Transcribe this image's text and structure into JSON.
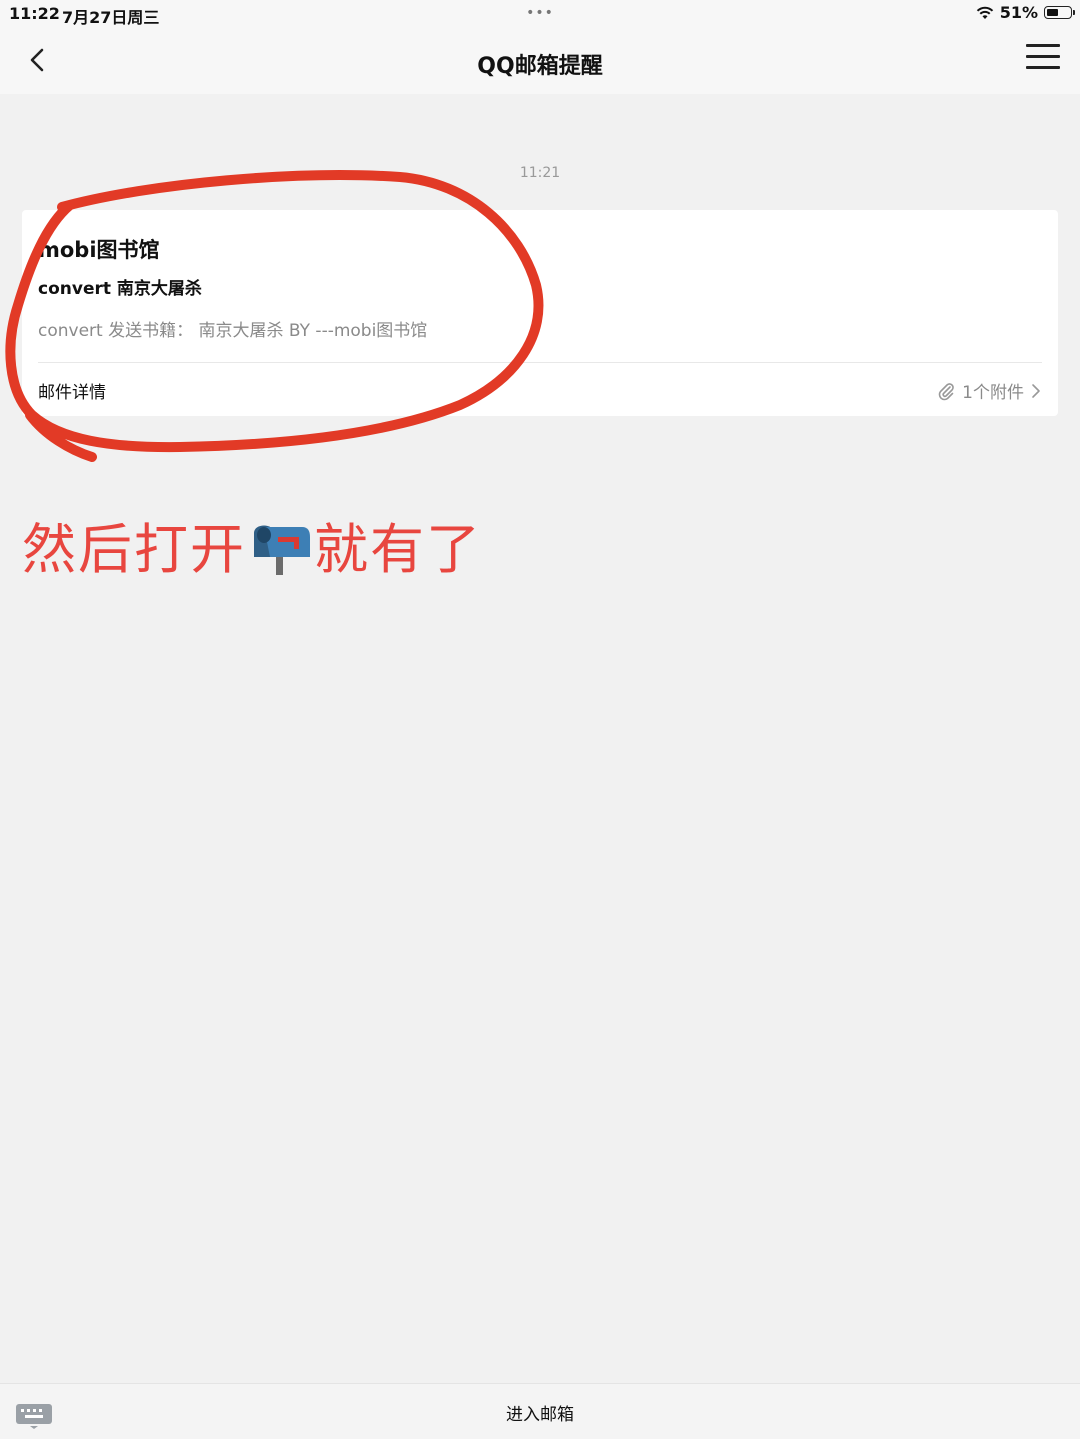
{
  "status_bar": {
    "time": "11:22",
    "date": "7月27日周三",
    "dots": "•••",
    "battery": "51%",
    "battery_level": 0.51
  },
  "nav": {
    "title": "QQ邮箱提醒",
    "back_icon": "chevron-left-icon",
    "menu_icon": "hamburger-menu-icon"
  },
  "message": {
    "time": "11:21",
    "sender": "mobi图书馆",
    "subject": "convert 南京大屠杀",
    "preview": "convert 发送书籍：  南京大屠杀 BY ---mobi图书馆",
    "details_label": "邮件详情",
    "attachment_label": "1个附件",
    "attachment_icon": "paperclip-icon",
    "chevron_icon": "chevron-right-icon"
  },
  "annotation": {
    "text_before": "然后打开",
    "text_after": "就有了",
    "emoji_icon": "mailbox-icon",
    "color": "#e8463f"
  },
  "bottom_bar": {
    "keyboard_icon": "keyboard-icon",
    "enter_label": "进入邮箱"
  }
}
